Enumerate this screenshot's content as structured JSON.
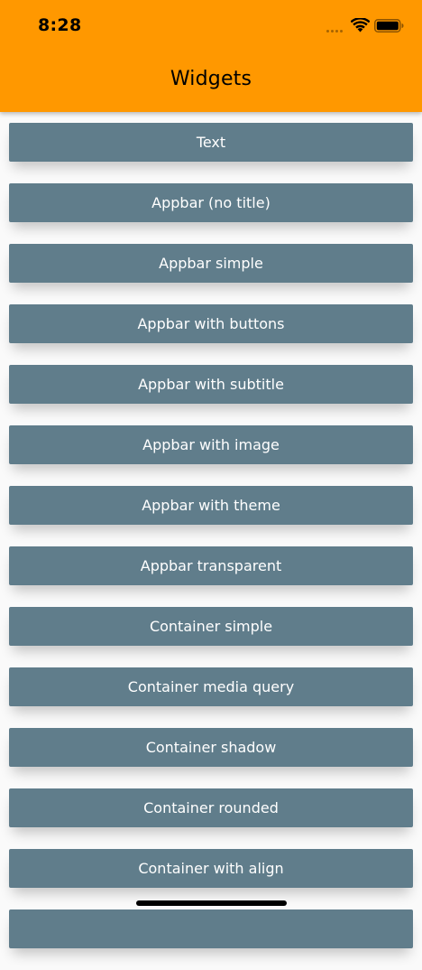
{
  "status_bar": {
    "time": "8:28",
    "icons": [
      "cellular-signal-icon",
      "wifi-icon",
      "battery-icon"
    ]
  },
  "appbar": {
    "title": "Widgets",
    "background": "#ff9800"
  },
  "colors": {
    "button_background": "#607d8b",
    "button_text": "#ffffff",
    "page_background": "#fafafa"
  },
  "list": {
    "items": [
      "Text",
      "Appbar (no title)",
      "Appbar simple",
      "Appbar with buttons",
      "Appbar with subtitle",
      "Appbar with image",
      "Appbar with theme",
      "Appbar transparent",
      "Container simple",
      "Container media query",
      "Container shadow",
      "Container rounded",
      "Container with align"
    ]
  }
}
